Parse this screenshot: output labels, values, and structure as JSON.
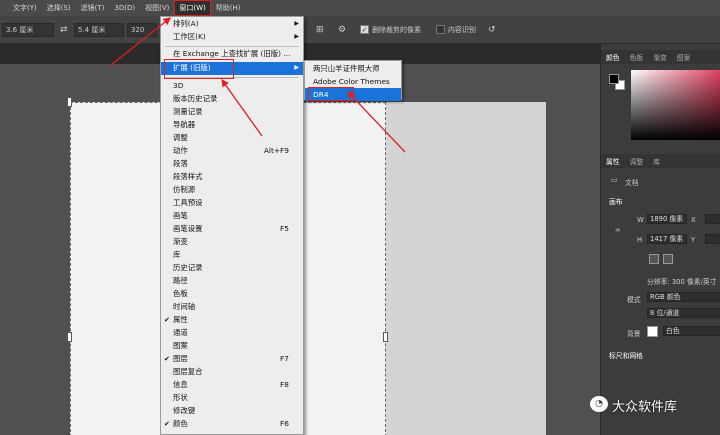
{
  "menubar": {
    "items": [
      "文字(Y)",
      "选择(S)",
      "滤镜(T)",
      "3D(D)",
      "视图(V)",
      "窗口(W)",
      "帮助(H)"
    ]
  },
  "options": {
    "field1": "3.6 厘米",
    "field2": "5.4 厘米",
    "field3": "320",
    "delete_cropped": "删除裁剪的像素",
    "content_aware": "内容识别"
  },
  "window_menu": {
    "items": [
      {
        "label": "排列(A)",
        "shortcut": "",
        "submenu": true,
        "checked": false
      },
      {
        "label": "工作区(K)",
        "shortcut": "",
        "submenu": true,
        "checked": false
      },
      {
        "label": "在 Exchange 上查找扩展 (旧版) ...",
        "shortcut": "",
        "submenu": false,
        "checked": false
      },
      {
        "label": "扩展 (旧版)",
        "shortcut": "",
        "submenu": true,
        "checked": false
      },
      {
        "label": "3D",
        "shortcut": "",
        "submenu": false,
        "checked": false
      },
      {
        "label": "版本历史记录",
        "shortcut": "",
        "submenu": false,
        "checked": false
      },
      {
        "label": "测量记录",
        "shortcut": "",
        "submenu": false,
        "checked": false
      },
      {
        "label": "导航器",
        "shortcut": "",
        "submenu": false,
        "checked": false
      },
      {
        "label": "调整",
        "shortcut": "",
        "submenu": false,
        "checked": false
      },
      {
        "label": "动作",
        "shortcut": "Alt+F9",
        "submenu": false,
        "checked": false
      },
      {
        "label": "段落",
        "shortcut": "",
        "submenu": false,
        "checked": false
      },
      {
        "label": "段落样式",
        "shortcut": "",
        "submenu": false,
        "checked": false
      },
      {
        "label": "仿制源",
        "shortcut": "",
        "submenu": false,
        "checked": false
      },
      {
        "label": "工具预设",
        "shortcut": "",
        "submenu": false,
        "checked": false
      },
      {
        "label": "画笔",
        "shortcut": "",
        "submenu": false,
        "checked": false
      },
      {
        "label": "画笔设置",
        "shortcut": "F5",
        "submenu": false,
        "checked": false
      },
      {
        "label": "渐变",
        "shortcut": "",
        "submenu": false,
        "checked": false
      },
      {
        "label": "库",
        "shortcut": "",
        "submenu": false,
        "checked": false
      },
      {
        "label": "历史记录",
        "shortcut": "",
        "submenu": false,
        "checked": false
      },
      {
        "label": "路径",
        "shortcut": "",
        "submenu": false,
        "checked": false
      },
      {
        "label": "色板",
        "shortcut": "",
        "submenu": false,
        "checked": false
      },
      {
        "label": "时间轴",
        "shortcut": "",
        "submenu": false,
        "checked": false
      },
      {
        "label": "属性",
        "shortcut": "",
        "submenu": false,
        "checked": true
      },
      {
        "label": "通道",
        "shortcut": "",
        "submenu": false,
        "checked": false
      },
      {
        "label": "图案",
        "shortcut": "",
        "submenu": false,
        "checked": false
      },
      {
        "label": "图层",
        "shortcut": "F7",
        "submenu": false,
        "checked": true
      },
      {
        "label": "图层复合",
        "shortcut": "",
        "submenu": false,
        "checked": false
      },
      {
        "label": "信息",
        "shortcut": "F8",
        "submenu": false,
        "checked": false
      },
      {
        "label": "形状",
        "shortcut": "",
        "submenu": false,
        "checked": false
      },
      {
        "label": "修改键",
        "shortcut": "",
        "submenu": false,
        "checked": false
      },
      {
        "label": "颜色",
        "shortcut": "F6",
        "submenu": false,
        "checked": true
      }
    ]
  },
  "ext_submenu": {
    "items": [
      "两只山羊证件照大师",
      "Adobe Color Themes",
      "DR4"
    ]
  },
  "panels": {
    "color_tabs": [
      "颜色",
      "色板",
      "渐变",
      "图案"
    ],
    "prop_tabs": [
      "属性",
      "调整",
      "库"
    ],
    "doc_label": "文档",
    "canvas_header": "画布",
    "w_label": "W",
    "w_value": "1890 像素",
    "x_label": "X",
    "h_label": "H",
    "h_value": "1417 像素",
    "y_label": "Y",
    "resolution": "分辨率: 300 像素/英寸",
    "mode_label": "模式",
    "mode_value": "RGB 颜色",
    "depth_value": "8 位/通道",
    "bg_label": "背景",
    "bg_value": "白色",
    "rulers_header": "标尺和网格"
  },
  "watermark": "大众软件库",
  "colors": {
    "highlight": "#1a73d9",
    "annotation": "#e02020"
  }
}
